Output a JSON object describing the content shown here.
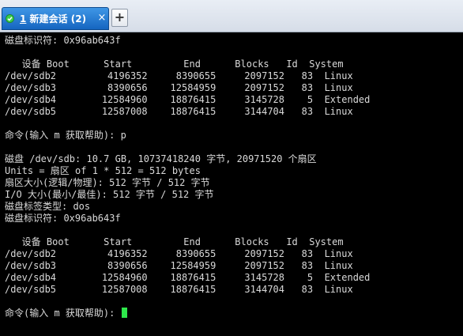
{
  "tabbar": {
    "tab": {
      "number": "1",
      "title": "新建会话",
      "badge": "(2)",
      "close_glyph": "×",
      "status_icon": "green-check-icon",
      "accent": "#1976d2"
    },
    "new_tab_glyph": "+"
  },
  "terminal": {
    "lines": [
      "磁盘标识符: 0x96ab643f",
      "",
      "   设备 Boot      Start         End      Blocks   Id  System",
      "/dev/sdb2         4196352     8390655     2097152   83  Linux",
      "/dev/sdb3         8390656    12584959     2097152   83  Linux",
      "/dev/sdb4        12584960    18876415     3145728    5  Extended",
      "/dev/sdb5        12587008    18876415     3144704   83  Linux",
      "",
      "命令(输入 m 获取帮助): p",
      "",
      "磁盘 /dev/sdb: 10.7 GB, 10737418240 字节, 20971520 个扇区",
      "Units = 扇区 of 1 * 512 = 512 bytes",
      "扇区大小(逻辑/物理): 512 字节 / 512 字节",
      "I/O 大小(最小/最佳): 512 字节 / 512 字节",
      "磁盘标签类型: dos",
      "磁盘标识符: 0x96ab643f",
      "",
      "   设备 Boot      Start         End      Blocks   Id  System",
      "/dev/sdb2         4196352     8390655     2097152   83  Linux",
      "/dev/sdb3         8390656    12584959     2097152   83  Linux",
      "/dev/sdb4        12584960    18876415     3145728    5  Extended",
      "/dev/sdb5        12587008    18876415     3144704   83  Linux",
      "",
      "命令(输入 m 获取帮助): "
    ],
    "text_color": "#d9d9d9",
    "cursor_color": "#2ee84b"
  }
}
